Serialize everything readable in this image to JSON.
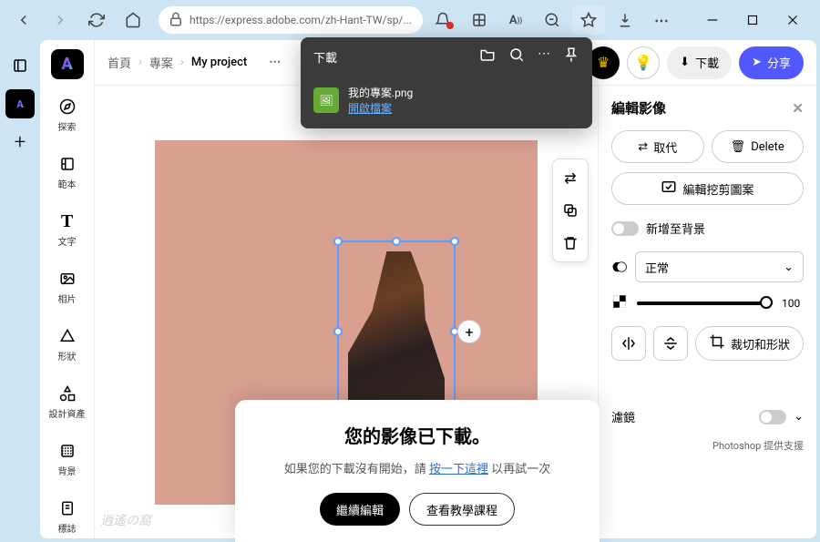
{
  "browser": {
    "url": "https://express.adobe.com/zh-Hant-TW/sp/..."
  },
  "download_popover": {
    "title": "下載",
    "filename": "我的專案.png",
    "open_label": "開啟檔案"
  },
  "breadcrumb": {
    "home": "首頁",
    "projects": "專案",
    "current": "My project"
  },
  "top_actions": {
    "download": "下載",
    "share": "分享"
  },
  "sidebar": {
    "items": [
      {
        "label": "探索"
      },
      {
        "label": "範本"
      },
      {
        "label": "文字"
      },
      {
        "label": "相片"
      },
      {
        "label": "形狀"
      },
      {
        "label": "設計資產"
      },
      {
        "label": "背景"
      },
      {
        "label": "標誌"
      }
    ]
  },
  "right_panel": {
    "title": "編輯影像",
    "replace": "取代",
    "delete": "Delete",
    "edit_cutout": "編輯挖剪圖案",
    "add_bg": "新增至背景",
    "blend_mode": "正常",
    "opacity": "100",
    "crop_shape": "裁切和形狀",
    "filter": "濾鏡",
    "ps_credit": "Photoshop 提供支援"
  },
  "modal": {
    "title": "您的影像已下載。",
    "sub_pre": "如果您的下載沒有開始，請 ",
    "sub_link": "按一下這裡",
    "sub_post": " 以再試一次",
    "continue": "繼續編輯",
    "tutorial": "查看教學課程"
  },
  "watermark": "逍遙の窩"
}
